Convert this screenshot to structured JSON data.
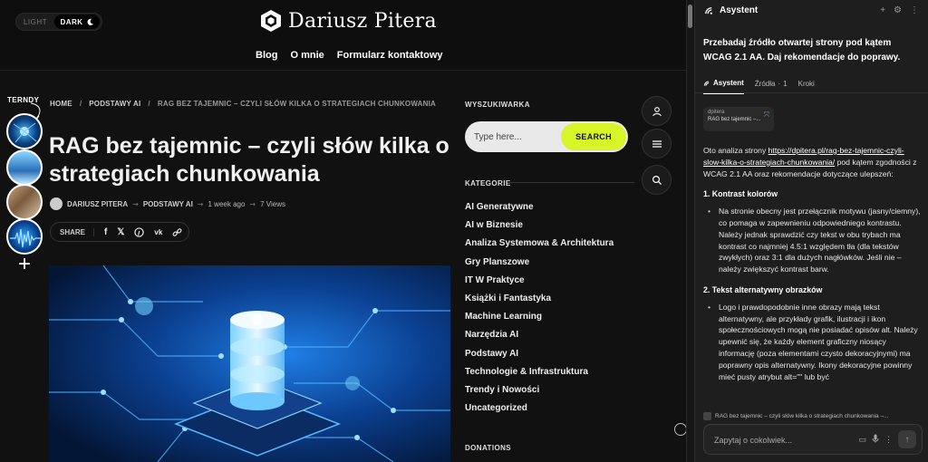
{
  "site": {
    "theme_toggle": {
      "light": "LIGHT",
      "dark": "DARK"
    },
    "brand": "Dariusz Pitera",
    "nav": [
      "Blog",
      "O mnie",
      "Formularz kontaktowy"
    ],
    "trendy_label": "TERNDY",
    "breadcrumb": {
      "home": "HOME",
      "sep": "/",
      "category": "PODSTAWY AI",
      "current": "RAG BEZ TAJEMNIC – CZYLI SŁÓW KILKA O STRATEGIACH CHUNKOWANIA"
    },
    "article": {
      "title": "RAG bez tajemnic – czyli słów kilka o strategiach chunkowania",
      "author": "DARIUSZ PITERA",
      "category": "PODSTAWY AI",
      "date": "1 week ago",
      "views": "7 Views",
      "share_label": "SHARE"
    },
    "sidebar": {
      "search_title": "WYSZUKIWARKA",
      "search_placeholder": "Type here...",
      "search_button": "SEARCH",
      "categories_title": "KATEGORIE",
      "categories": [
        "AI Generatywne",
        "AI w Biznesie",
        "Analiza Systemowa & Architektura",
        "Gry Planszowe",
        "IT W Praktyce",
        "Książki i Fantastyka",
        "Machine Learning",
        "Narzędzia AI",
        "Podstawy AI",
        "Technologie & Infrastruktura",
        "Trendy i Nowości",
        "Uncategorized"
      ],
      "donations_title": "DONATIONS"
    }
  },
  "assistant": {
    "title": "Asystent",
    "prompt": "Przebadaj źródło otwartej strony pod kątem WCAG 2.1 AA. Daj rekomendacje do poprawy.",
    "tabs": {
      "assistant": "Asystent",
      "sources": "Źródła",
      "sources_count": "1",
      "steps": "Kroki"
    },
    "source_card": {
      "domain": "dpitera",
      "title": "RAG bez tajemnic –..."
    },
    "answer": {
      "intro_before": "Oto analiza strony ",
      "link": "https://dpitera.pl/rag-bez-tajemnic-czyli-slow-kilka-o-strategiach-chunkowania/",
      "intro_after": " pod kątem zgodności z WCAG 2.1 AA oraz rekomendacje dotyczące ulepszeń:",
      "h1": "1. Kontrast kolorów",
      "p1": "Na stronie obecny jest przełącznik motywu (jasny/ciemny), co pomaga w zapewnieniu odpowiedniego kontrastu. Należy jednak sprawdzić czy tekst w obu trybach ma kontrast co najmniej 4.5:1 względem tła (dla tekstów zwykłych) oraz 3:1 dla dużych nagłówków. Jeśli nie – należy zwiększyć kontrast barw.",
      "h2": "2. Tekst alternatywny obrazków",
      "p2": "Logo i prawdopodobnie inne obrazy mają tekst alternatywny, ale przykłady grafik, ilustracji i ikon społecznościowych mogą nie posiadać opisów alt. Należy upewnić się, że każdy element graficzny niosący informację (poza elementami czysto dekoracyjnymi) ma poprawny opis alternatywny. Ikony dekoracyjne powinny mieć pusty atrybut alt=\"\" lub być"
    },
    "context_tab": "RAG bez tajemnic – czyli słów kilka o strategiach chunkowania –...",
    "input_placeholder": "Zapytaj o cokolwiek..."
  },
  "colors": {
    "accent": "#d8f52a",
    "background": "#111111",
    "panel": "#1e1e1e"
  }
}
